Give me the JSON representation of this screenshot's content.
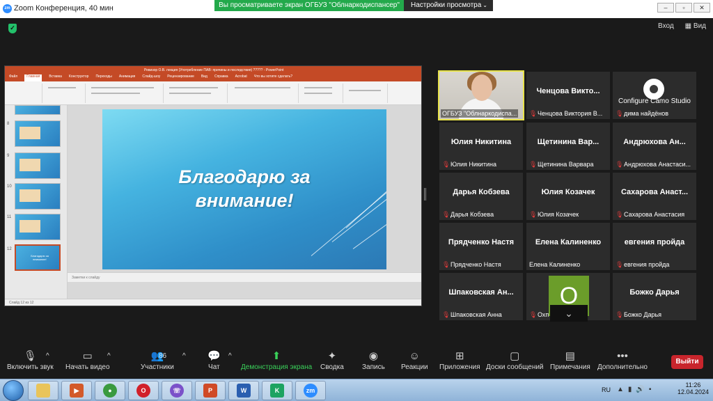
{
  "window": {
    "title": "Zoom Конференция, 40 мин",
    "share_banner": "Вы просматриваете экран ОГБУЗ \"Облнаркодиспансер\"",
    "view_settings": "Настройки просмотра"
  },
  "top_right": {
    "enter": "Вход",
    "view": "Вид"
  },
  "shared_screen": {
    "ppt_title": "Ревизор О.В. лекция (Употребление ПАВ: причины и последствия) ????? - PowerPoint",
    "ppt_tabs": [
      "Файл",
      "Главная",
      "Вставка",
      "Конструктор",
      "Переходы",
      "Анимация",
      "Слайд-шоу",
      "Рецензирование",
      "Вид",
      "Справка",
      "Acrobat",
      "Что вы хотите сделать?"
    ],
    "thumb_numbers": [
      "8",
      "9",
      "10",
      "11",
      "12"
    ],
    "selected_thumb_text": "Благодарю за внимание!",
    "slide_text_line1": "Благодарю за",
    "slide_text_line2": "внимание!",
    "notes_placeholder": "Заметки к слайду",
    "status_text": "Слайд 12 из 12"
  },
  "participants": [
    {
      "big": "",
      "name": "ОГБУЗ \"Облнаркодиспа...",
      "type": "video",
      "muted": false,
      "active": true
    },
    {
      "big": "Ченцова Викто...",
      "name": "Ченцова Виктория В...",
      "muted": true
    },
    {
      "big": "Configure Camo Studio",
      "name": "дима найдёнов",
      "type": "gear",
      "muted": true
    },
    {
      "big": "Юлия Никитина",
      "name": "Юлия Никитина",
      "muted": true
    },
    {
      "big": "Щетинина Вар...",
      "name": "Щетинина Варвара",
      "muted": true
    },
    {
      "big": "Андрюхова Ан...",
      "name": "Андрюхова Анастаси...",
      "muted": true
    },
    {
      "big": "Дарья Кобзева",
      "name": "Дарья Кобзева",
      "muted": true
    },
    {
      "big": "Юлия Козачек",
      "name": "Юлия Козачек",
      "muted": true
    },
    {
      "big": "Сахарова Анаст...",
      "name": "Сахарова Анастасия",
      "muted": true
    },
    {
      "big": "Прядченко Настя",
      "name": "Прядченко Настя",
      "muted": true
    },
    {
      "big": "Елена Калиненко",
      "name": "Елена Калиненко",
      "muted": false
    },
    {
      "big": "евгения пройда",
      "name": "евгения пройда",
      "muted": true
    },
    {
      "big": "Шпаковская Ан...",
      "name": "Шпаковская Анна",
      "muted": true
    },
    {
      "big": "О",
      "name": "Охп",
      "type": "avatar",
      "muted": true
    },
    {
      "big": "Божко Дарья",
      "name": "Божко Дарья",
      "muted": true
    }
  ],
  "toolbar": {
    "mute": "Включить звук",
    "video": "Начать видео",
    "participants": "Участники",
    "participants_count": "86",
    "chat": "Чат",
    "share": "Демонстрация экрана",
    "summary": "Сводка",
    "record": "Запись",
    "reactions": "Реакции",
    "apps": "Приложения",
    "whiteboards": "Доски сообщений",
    "notes": "Примечания",
    "more": "Дополнительно",
    "leave": "Выйти"
  },
  "taskbar": {
    "lang": "RU",
    "time": "11:26",
    "date": "12.04.2024"
  },
  "colors": {
    "share_green": "#23a94b",
    "leave_red": "#c8252c",
    "active_speaker": "#e7e24a",
    "ppt_orange": "#c44a26"
  }
}
